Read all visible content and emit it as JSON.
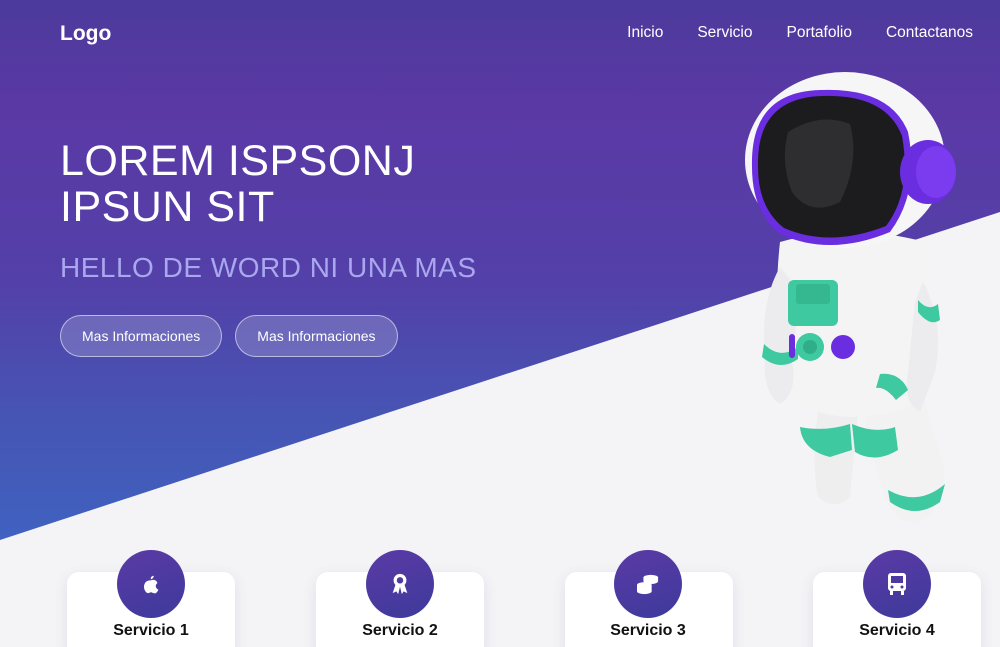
{
  "nav": {
    "logo": "Logo",
    "items": [
      "Inicio",
      "Servicio",
      "Portafolio",
      "Contactanos"
    ]
  },
  "hero": {
    "title_line1": "LOREM ISPSONJ",
    "title_line2": "IPSUN SIT",
    "subtitle": "HELLO DE WORD NI UNA MAS",
    "button1": "Mas Informaciones",
    "button2": "Mas Informaciones"
  },
  "services": [
    {
      "label": "Servicio 1",
      "icon": "apple-icon"
    },
    {
      "label": "Servicio 2",
      "icon": "award-icon"
    },
    {
      "label": "Servicio 3",
      "icon": "coins-icon"
    },
    {
      "label": "Servicio 4",
      "icon": "bus-icon"
    }
  ],
  "colors": {
    "accent": "#5b3aa6",
    "teal": "#3ec9a0",
    "subtitle": "#a9a7ee"
  }
}
